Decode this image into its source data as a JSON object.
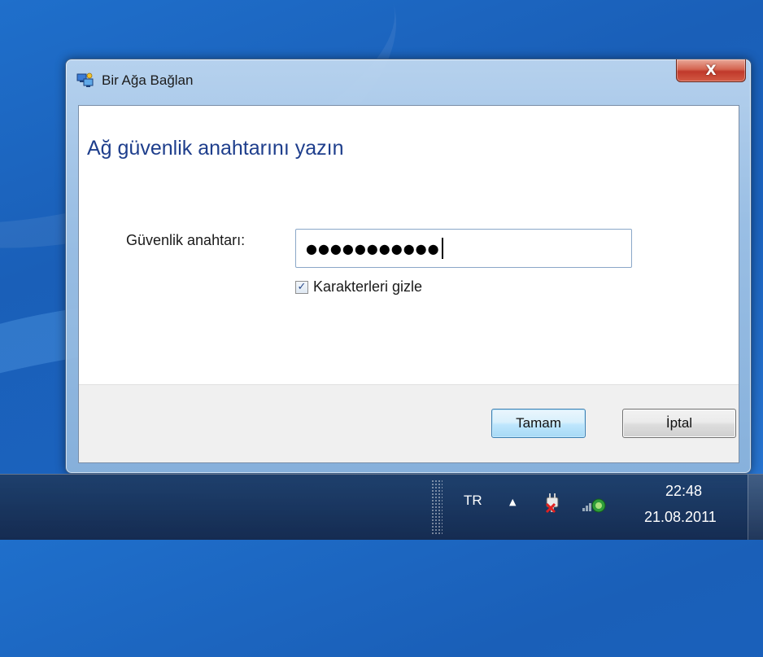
{
  "window": {
    "title": "Bir Ağa Bağlan",
    "close_label": "X"
  },
  "dialog": {
    "heading": "Ağ güvenlik anahtarını yazın",
    "key_label": "Güvenlik anahtarı:",
    "key_value_masked": "●●●●●●●●●●●",
    "hide_characters_label": "Karakterleri gizle",
    "hide_characters_checked": true,
    "ok_label": "Tamam",
    "cancel_label": "İptal"
  },
  "taskbar": {
    "language": "TR",
    "time": "22:48",
    "date": "21.08.2011",
    "tray_icons": [
      "show-hidden-icons-arrow",
      "power-icon",
      "network-icon"
    ]
  },
  "colors": {
    "heading": "#1e3e8c",
    "close_button": "#c0392b",
    "desktop": "#1b62bd"
  }
}
